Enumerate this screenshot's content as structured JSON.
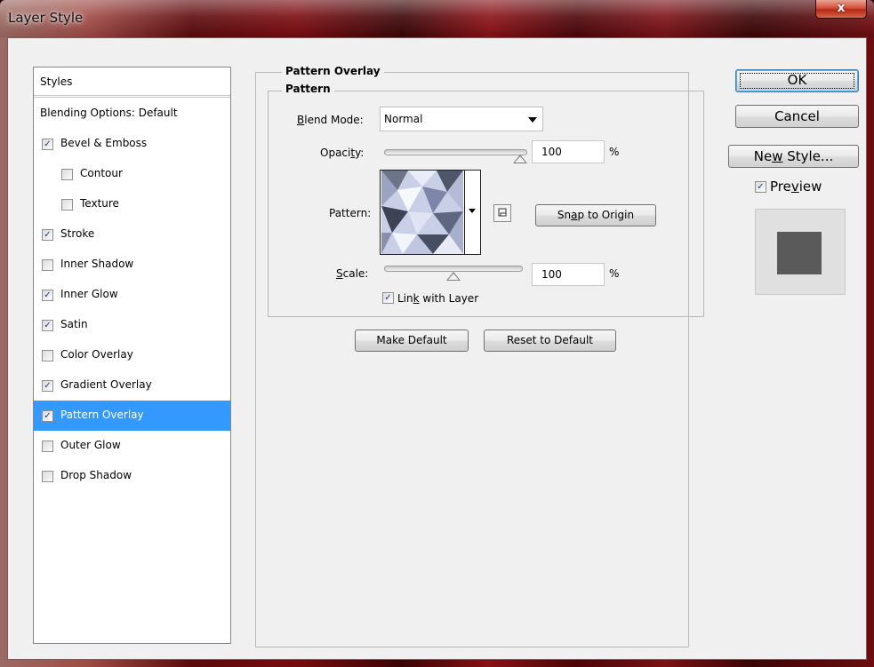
{
  "window": {
    "title": "Layer Style",
    "close_glyph": "x"
  },
  "styles_list": {
    "header": "Styles",
    "items": [
      {
        "label": "Blending Options: Default",
        "checkbox": false,
        "checked": false,
        "selected": false,
        "indent": 0
      },
      {
        "label": "Bevel & Emboss",
        "checkbox": true,
        "checked": true,
        "selected": false,
        "indent": 0
      },
      {
        "label": "Contour",
        "checkbox": true,
        "checked": false,
        "selected": false,
        "indent": 1
      },
      {
        "label": "Texture",
        "checkbox": true,
        "checked": false,
        "selected": false,
        "indent": 1
      },
      {
        "label": "Stroke",
        "checkbox": true,
        "checked": true,
        "selected": false,
        "indent": 0
      },
      {
        "label": "Inner Shadow",
        "checkbox": true,
        "checked": false,
        "selected": false,
        "indent": 0
      },
      {
        "label": "Inner Glow",
        "checkbox": true,
        "checked": true,
        "selected": false,
        "indent": 0
      },
      {
        "label": "Satin",
        "checkbox": true,
        "checked": true,
        "selected": false,
        "indent": 0
      },
      {
        "label": "Color Overlay",
        "checkbox": true,
        "checked": false,
        "selected": false,
        "indent": 0
      },
      {
        "label": "Gradient Overlay",
        "checkbox": true,
        "checked": true,
        "selected": false,
        "indent": 0
      },
      {
        "label": "Pattern Overlay",
        "checkbox": true,
        "checked": true,
        "selected": true,
        "indent": 0
      },
      {
        "label": "Outer Glow",
        "checkbox": true,
        "checked": false,
        "selected": false,
        "indent": 0
      },
      {
        "label": "Drop Shadow",
        "checkbox": true,
        "checked": false,
        "selected": false,
        "indent": 0
      }
    ]
  },
  "panel": {
    "title": "Pattern Overlay",
    "group_title": "Pattern",
    "blend_mode": {
      "label_pre": "",
      "label_u": "B",
      "label_post": "lend Mode:",
      "value": "Normal"
    },
    "opacity": {
      "label_pre": "Opaci",
      "label_u": "t",
      "label_post": "y:",
      "value": "100",
      "unit": "%",
      "level": 1.0
    },
    "pattern": {
      "label": "Pattern:",
      "snap_label_pre": "Sn",
      "snap_label_u": "a",
      "snap_label_post": "p to Origin"
    },
    "scale": {
      "label_pre": "",
      "label_u": "S",
      "label_post": "cale:",
      "value": "100",
      "unit": "%",
      "level": 0.5
    },
    "link": {
      "label_pre": "Lin",
      "label_u": "k",
      "label_post": " with Layer",
      "checked": true
    },
    "make_default": "Make Default",
    "reset_default": "Reset to Default"
  },
  "right": {
    "ok": "OK",
    "cancel": "Cancel",
    "new_style_pre": "Ne",
    "new_style_u": "w",
    "new_style_post": " Style...",
    "preview_pre": "Pre",
    "preview_u": "v",
    "preview_post": "iew",
    "preview_checked": true
  },
  "colors": {
    "selection": "#3399ff",
    "dialog_bg": "#f0f0f0",
    "close_red": "#c8412a",
    "preview_square": "#5a5a5a"
  },
  "icons": {
    "close": "close-icon",
    "dropdown": "chevron-down-icon",
    "pattern_new": "new-pattern-icon",
    "check": "checkmark-icon"
  }
}
